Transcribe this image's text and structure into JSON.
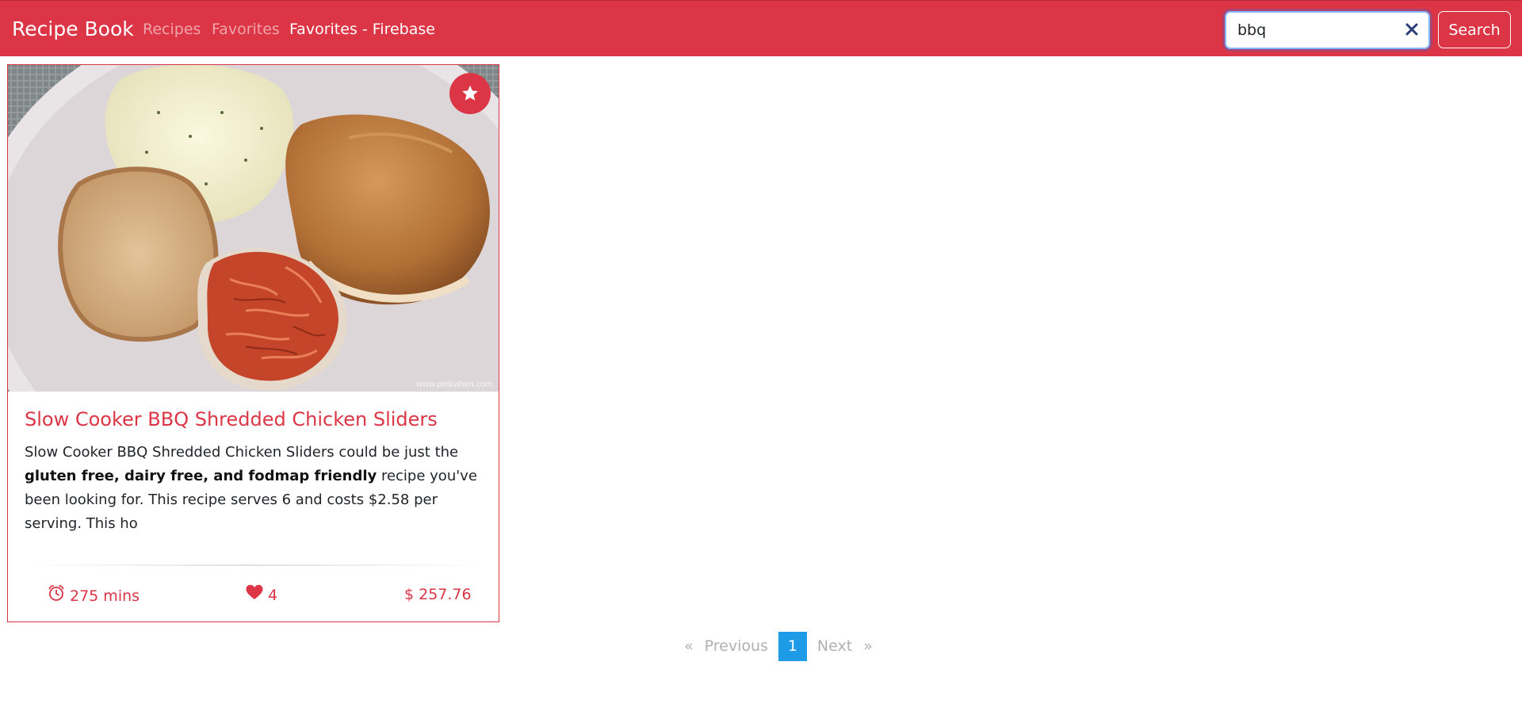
{
  "navbar": {
    "brand": "Recipe Book",
    "links": [
      "Recipes",
      "Favorites",
      "Favorites - Firebase"
    ],
    "active_link": "Favorites - Firebase",
    "accent_color": "#dc3545"
  },
  "search": {
    "value": "bbq",
    "clear_icon": "close-icon",
    "button_label": "Search"
  },
  "recipe": {
    "title": "Slow Cooker BBQ Shredded Chicken Sliders",
    "summary_part1": "Slow Cooker BBQ Shredded Chicken Sliders could be just the ",
    "summary_bold": "gluten free, dairy free, and fodmap friendly",
    "summary_part2": " recipe you've been looking for. This recipe serves 6 and costs $2.58 per serving. This ho",
    "image_watermark": "www.pinkwhen.com",
    "favorite_icon": "star-icon",
    "ready_time": "275 mins",
    "likes": "4",
    "price": "$ 257.76",
    "time_icon": "alarm-clock-icon",
    "likes_icon": "heart-icon"
  },
  "pagination": {
    "first": "«",
    "previous": "Previous",
    "current_page": "1",
    "next": "Next",
    "last": "»",
    "current_color": "#1e9be6"
  }
}
